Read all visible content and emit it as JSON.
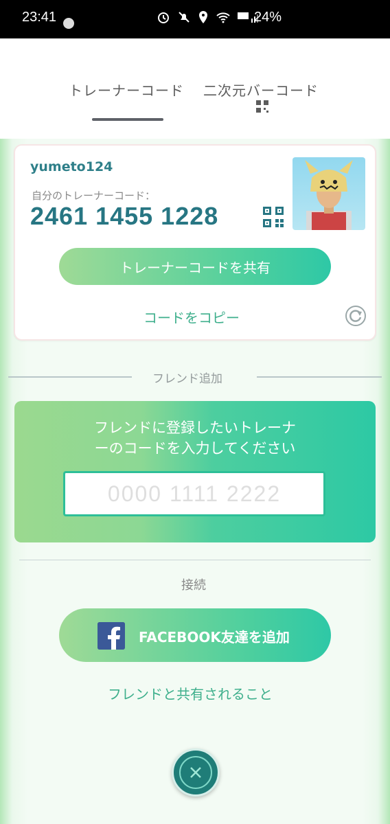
{
  "status_bar": {
    "time": "23:41",
    "battery": "24%"
  },
  "tabs": [
    {
      "label": "トレーナーコード",
      "selected": true
    },
    {
      "label": "二次元バーコード",
      "selected": false
    }
  ],
  "trainer_card": {
    "username": "yumeto124",
    "code_label": "自分のトレーナーコード：",
    "code": "2461 1455 1228",
    "share_button": "トレーナーコードを共有",
    "copy_link": "コードをコピー"
  },
  "add_friend": {
    "section_label": "フレンド追加",
    "instruction_line1": "フレンドに登録したいトレーナ",
    "instruction_line2": "ーのコードを入力してください",
    "input_placeholder": "0000 1111 2222",
    "input_value": ""
  },
  "connect": {
    "section_label": "接続",
    "facebook_button": "FACEBOOK友達を追加",
    "shared_info_link": "フレンドと共有されること"
  },
  "colors": {
    "accent_teal": "#277683",
    "link_green": "#3eaf8c",
    "facebook_blue": "#3b5998"
  },
  "icons": [
    "qr-code-icon",
    "refresh-icon",
    "facebook-icon",
    "close-icon",
    "alarm-icon",
    "mute-icon",
    "location-icon",
    "wifi-icon",
    "signal-icon",
    "battery-icon"
  ]
}
